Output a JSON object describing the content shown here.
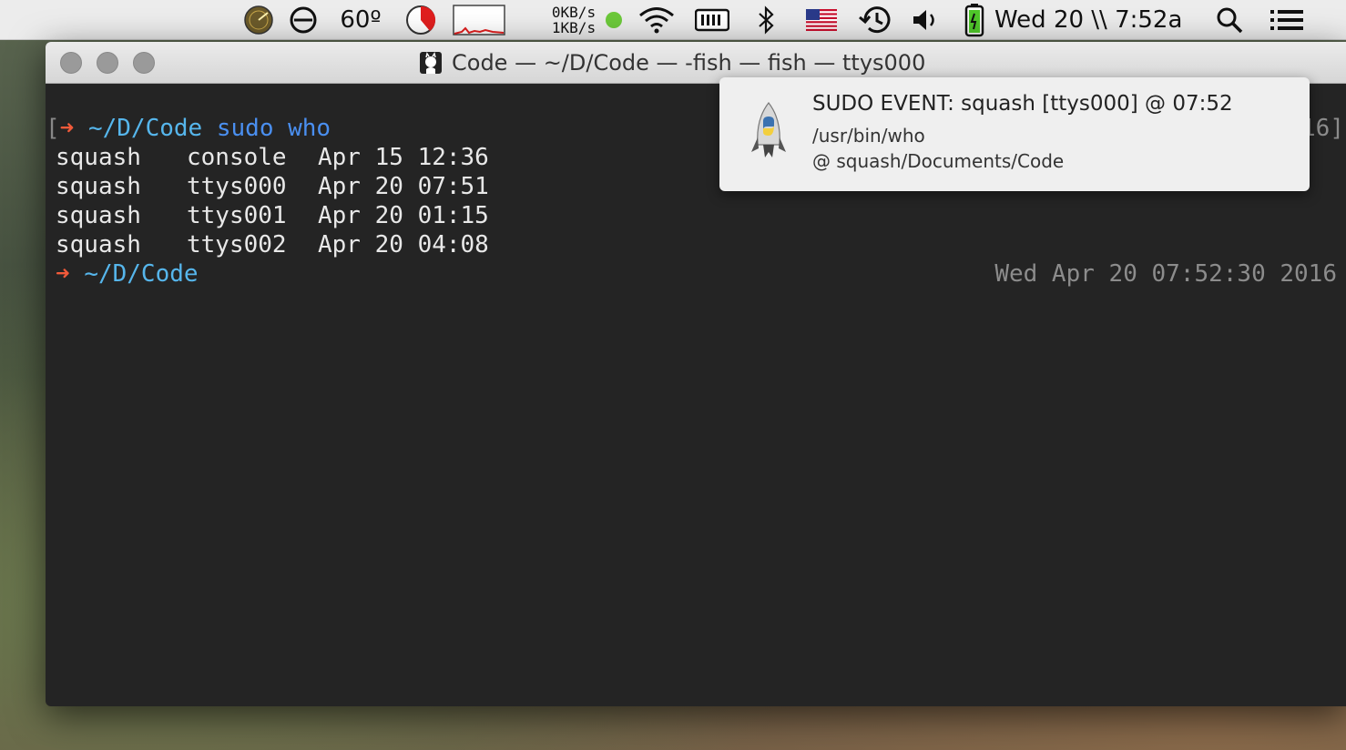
{
  "menubar": {
    "temperature": "60º",
    "net_down": "0KB/s",
    "net_up": "1KB/s",
    "clock": "Wed 20 \\\\ 7:52a",
    "icons": [
      "radar-icon",
      "sync-icon",
      "cpu-pie-icon",
      "activity-graph-icon",
      "status-dot-icon",
      "wifi-icon",
      "battery-bars-icon",
      "bluetooth-icon",
      "us-flag-icon",
      "time-machine-icon",
      "volume-icon",
      "battery-icon",
      "search-icon",
      "list-icon"
    ]
  },
  "window": {
    "title": "Code — ~/D/Code — -fish — fish — ttys000"
  },
  "terminal": {
    "prompt_bracket": "[",
    "prompt_arrow": "➜",
    "prompt_path": "~/D/Code",
    "command": "sudo who",
    "right_fragment": "16]",
    "rows": [
      {
        "user": "squash",
        "tty": "console",
        "date": "Apr 15 12:36"
      },
      {
        "user": "squash",
        "tty": "ttys000",
        "date": "Apr 20 07:51"
      },
      {
        "user": "squash",
        "tty": "ttys001",
        "date": "Apr 20 01:15"
      },
      {
        "user": "squash",
        "tty": "ttys002",
        "date": "Apr 20 04:08"
      }
    ],
    "prompt2_arrow": "➜",
    "prompt2_path": "~/D/Code",
    "right_timestamp": "Wed Apr 20 07:52:30 2016"
  },
  "notification": {
    "title": "SUDO EVENT: squash [ttys000] @ 07:52",
    "line1": "/usr/bin/who",
    "line2": "@ squash/Documents/Code",
    "icon": "python-rocket-icon"
  },
  "colors": {
    "arrow": "#f15a3a",
    "path": "#56b6ec",
    "command": "#4a8ff0"
  }
}
